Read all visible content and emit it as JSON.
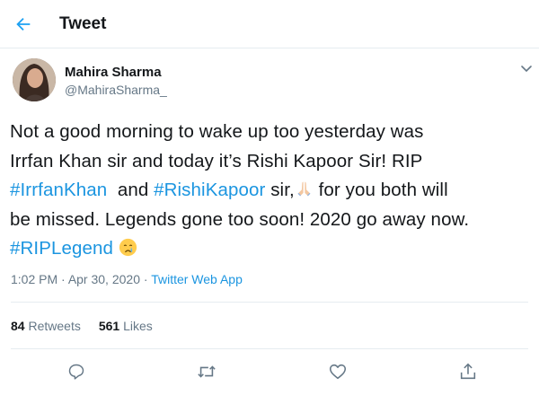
{
  "header": {
    "title": "Tweet",
    "back_icon": "back-arrow-icon"
  },
  "colors": {
    "accent": "#1da1f2",
    "link": "#1b95e0",
    "secondary": "#657786",
    "text": "#14171a"
  },
  "author": {
    "name": "Mahira Sharma",
    "handle": "@MahiraSharma_",
    "menu_icon": "chevron-down-icon"
  },
  "tweet": {
    "line1": "Not a good morning to wake up too yesterday was",
    "line2": "Irrfan Khan sir and today it’s Rishi Kapoor Sir! RIP",
    "hashtag_irrfan": "#IrrfanKhan",
    "text_and": "  and ",
    "hashtag_rishi": "#RishiKapoor",
    "text_sir": " sir,",
    "emoji_pray": "folded-hands-emoji",
    "text_foryou": " for you both will",
    "line4": "be missed. Legends gone too soon! 2020 go away now.",
    "hashtag_rip": "#RIPLegend",
    "emoji_cry": "crying-face-emoji"
  },
  "meta": {
    "time": "1:02 PM",
    "separator": " · ",
    "date": "Apr 30, 2020",
    "source": "Twitter Web App"
  },
  "stats": {
    "retweets_count": "84",
    "retweets_label": "Retweets",
    "likes_count": "561",
    "likes_label": "Likes"
  },
  "actions": [
    "reply-icon",
    "retweet-icon",
    "like-icon",
    "share-icon"
  ]
}
